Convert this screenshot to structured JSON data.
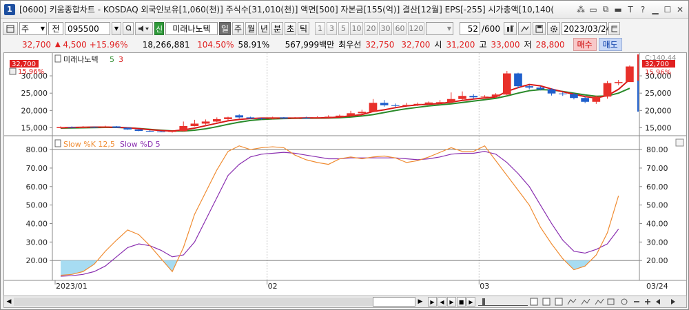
{
  "window": {
    "number": "1",
    "title": "[0600] 키움종합차트 - KOSDAQ 외국인보유[1,060(천)] 주식수[31,010(천)] 액면[500] 자본금[155(억)] 결산[12월] EPS[-255] 시가총액[10,140(",
    "controls": [
      "⁂",
      "▭",
      "⧉",
      "▬",
      "T",
      "?",
      "▁",
      "☐",
      "✕"
    ]
  },
  "toolbar": {
    "type_label": "주",
    "all_label": "전",
    "code_value": "095500",
    "stock_badge": "신",
    "stock_name": "미래나노텍",
    "period_tabs": [
      "일",
      "주",
      "월",
      "년",
      "분",
      "초",
      "틱"
    ],
    "minute_options": [
      "1",
      "3",
      "5",
      "10",
      "20",
      "30",
      "60",
      "120"
    ],
    "count_value": "52",
    "count_total": "/600",
    "date_value": "2023/03/24"
  },
  "quote": {
    "price": "32,700",
    "change": "4,500",
    "change_pct": "+15.96%",
    "volume": "18,266,881",
    "ratio1": "104.50%",
    "ratio2": "58.91%",
    "amount": "567,999백만",
    "best_label": "최우선",
    "best_sell": "32,750",
    "best_buy": "32,700",
    "open_label": "시",
    "open": "31,200",
    "high_label": "고",
    "high": "33,000",
    "low_label": "저",
    "low": "28,800",
    "buy_label": "매수",
    "sell_label": "매도"
  },
  "price_panel": {
    "name_label": "미래나노텍",
    "ma_short": "5",
    "ma_long": "3",
    "price_tag": "32,700",
    "pct_tag": "15.96%",
    "right_top_label": "C:140.44",
    "y_labels": [
      "30,000",
      "25,000",
      "20,000",
      "15,000"
    ]
  },
  "stoch_panel": {
    "label_k": "Slow %K 12,5",
    "label_d": "Slow %D 5",
    "y_labels": [
      "80.00",
      "70.00",
      "60.00",
      "50.00",
      "40.00",
      "30.00",
      "20.00"
    ]
  },
  "x_axis": {
    "labels": [
      "2023/01",
      "02",
      "03"
    ],
    "right_label": "03/24"
  },
  "chart_data": {
    "type": "line",
    "x_unit": "trading-day index",
    "candles": [
      {
        "o": 14900,
        "c": 15200,
        "h": 15400,
        "l": 14800
      },
      {
        "o": 15200,
        "c": 15000,
        "h": 15400,
        "l": 14900
      },
      {
        "o": 15000,
        "c": 15300,
        "h": 15500,
        "l": 14900
      },
      {
        "o": 15300,
        "c": 15100,
        "h": 15400,
        "l": 14900
      },
      {
        "o": 15100,
        "c": 15400,
        "h": 15600,
        "l": 15000
      },
      {
        "o": 15400,
        "c": 15000,
        "h": 15500,
        "l": 14900
      },
      {
        "o": 15000,
        "c": 14500,
        "h": 15100,
        "l": 14400
      },
      {
        "o": 14500,
        "c": 14100,
        "h": 14600,
        "l": 14000
      },
      {
        "o": 14100,
        "c": 13900,
        "h": 14300,
        "l": 13800
      },
      {
        "o": 13900,
        "c": 13800,
        "h": 14100,
        "l": 13700
      },
      {
        "o": 13800,
        "c": 14000,
        "h": 14200,
        "l": 13600
      },
      {
        "o": 14000,
        "c": 15500,
        "h": 16800,
        "l": 13900
      },
      {
        "o": 15500,
        "c": 16200,
        "h": 17300,
        "l": 15400
      },
      {
        "o": 16200,
        "c": 16800,
        "h": 17400,
        "l": 15900
      },
      {
        "o": 16800,
        "c": 17500,
        "h": 18000,
        "l": 16600
      },
      {
        "o": 17500,
        "c": 18000,
        "h": 18200,
        "l": 17200
      },
      {
        "o": 18600,
        "c": 18000,
        "h": 18900,
        "l": 17700
      },
      {
        "o": 18000,
        "c": 17700,
        "h": 18200,
        "l": 17500
      },
      {
        "o": 17700,
        "c": 17600,
        "h": 17900,
        "l": 17300
      },
      {
        "o": 17600,
        "c": 18000,
        "h": 18200,
        "l": 17400
      },
      {
        "o": 18000,
        "c": 17700,
        "h": 18100,
        "l": 17500
      },
      {
        "o": 17700,
        "c": 17900,
        "h": 18100,
        "l": 17500
      },
      {
        "o": 17900,
        "c": 17800,
        "h": 18200,
        "l": 17600
      },
      {
        "o": 17800,
        "c": 18000,
        "h": 18300,
        "l": 17700
      },
      {
        "o": 18000,
        "c": 18200,
        "h": 18600,
        "l": 17900
      },
      {
        "o": 18200,
        "c": 18500,
        "h": 18800,
        "l": 18100
      },
      {
        "o": 18500,
        "c": 19200,
        "h": 19900,
        "l": 18300
      },
      {
        "o": 19200,
        "c": 19600,
        "h": 20200,
        "l": 18900
      },
      {
        "o": 19600,
        "c": 22200,
        "h": 23300,
        "l": 19500
      },
      {
        "o": 22200,
        "c": 21500,
        "h": 23000,
        "l": 21100
      },
      {
        "o": 21500,
        "c": 21300,
        "h": 22000,
        "l": 21000
      },
      {
        "o": 21300,
        "c": 21600,
        "h": 22200,
        "l": 21000
      },
      {
        "o": 21600,
        "c": 21900,
        "h": 22300,
        "l": 21300
      },
      {
        "o": 21900,
        "c": 22300,
        "h": 22600,
        "l": 21700
      },
      {
        "o": 22300,
        "c": 22400,
        "h": 23000,
        "l": 22000
      },
      {
        "o": 22400,
        "c": 23300,
        "h": 25200,
        "l": 22200
      },
      {
        "o": 23300,
        "c": 24200,
        "h": 25500,
        "l": 23000
      },
      {
        "o": 24200,
        "c": 23800,
        "h": 24700,
        "l": 23400
      },
      {
        "o": 23800,
        "c": 24000,
        "h": 24400,
        "l": 23500
      },
      {
        "o": 24000,
        "c": 24600,
        "h": 25000,
        "l": 23700
      },
      {
        "o": 24600,
        "c": 30700,
        "h": 31400,
        "l": 24400
      },
      {
        "o": 30700,
        "c": 27000,
        "h": 30900,
        "l": 26400
      },
      {
        "o": 27000,
        "c": 26600,
        "h": 27400,
        "l": 26100
      },
      {
        "o": 26600,
        "c": 26100,
        "h": 27000,
        "l": 25800
      },
      {
        "o": 26100,
        "c": 24900,
        "h": 26400,
        "l": 24300
      },
      {
        "o": 24900,
        "c": 24700,
        "h": 25300,
        "l": 24200
      },
      {
        "o": 24700,
        "c": 23600,
        "h": 25000,
        "l": 23200
      },
      {
        "o": 23600,
        "c": 22500,
        "h": 24000,
        "l": 22100
      },
      {
        "o": 22500,
        "c": 24000,
        "h": 24300,
        "l": 21900
      },
      {
        "o": 24000,
        "c": 27900,
        "h": 28500,
        "l": 23400
      },
      {
        "o": 27900,
        "c": 28200,
        "h": 28800,
        "l": 27300
      },
      {
        "o": 28200,
        "c": 32700,
        "h": 33000,
        "l": 28800
      }
    ],
    "ma_short": [
      15000,
      15100,
      15150,
      15180,
      15200,
      15150,
      15000,
      14750,
      14450,
      14200,
      14050,
      14400,
      14900,
      15600,
      16300,
      17000,
      17400,
      17650,
      17800,
      17800,
      17800,
      17800,
      17850,
      17850,
      17900,
      18100,
      18450,
      18800,
      19700,
      20200,
      20800,
      21300,
      21600,
      21800,
      22000,
      22400,
      22900,
      23300,
      23600,
      23900,
      25500,
      26600,
      27500,
      27100,
      26200,
      25400,
      24700,
      24000,
      23600,
      24300,
      26100,
      29000
    ],
    "ma_long": [
      14900,
      14950,
      15000,
      15050,
      15100,
      15100,
      15000,
      14800,
      14550,
      14300,
      14100,
      14050,
      14300,
      14700,
      15300,
      16000,
      16600,
      17100,
      17400,
      17550,
      17650,
      17700,
      17750,
      17750,
      17800,
      17900,
      18100,
      18400,
      18800,
      19400,
      20000,
      20500,
      20900,
      21300,
      21600,
      21900,
      22300,
      22700,
      23100,
      23500,
      24200,
      25000,
      25700,
      26000,
      25900,
      25500,
      25000,
      24500,
      24100,
      24200,
      25000,
      26400
    ],
    "slow_k": [
      12,
      12.5,
      14,
      18,
      25,
      31,
      36.5,
      34,
      28,
      21,
      14,
      27,
      45,
      57,
      69,
      79,
      82,
      80,
      81,
      81.5,
      81,
      77,
      74.5,
      73,
      72,
      75,
      76,
      75,
      76,
      76.5,
      75.5,
      73,
      74,
      76,
      78.5,
      81,
      79,
      79,
      82,
      74,
      66,
      58,
      50,
      38,
      29,
      21,
      15,
      17,
      23,
      35,
      55
    ],
    "slow_d": [
      11.5,
      11.8,
      12.5,
      14,
      17,
      22,
      27,
      29,
      28,
      25.5,
      22,
      23,
      30,
      42,
      54,
      66,
      72,
      76,
      77.5,
      78,
      78.5,
      78,
      77,
      76,
      75,
      75,
      75.5,
      75.5,
      75.5,
      75.5,
      75.5,
      75,
      74.5,
      75,
      76,
      77.5,
      78,
      78,
      79,
      77.5,
      73,
      67,
      60,
      50,
      40,
      31,
      25,
      24,
      26,
      29,
      37
    ],
    "k_threshold_high": 80,
    "k_threshold_low": 20,
    "price_ylim": [
      13500,
      33000
    ],
    "stoch_ylim": [
      10,
      86
    ],
    "month_starts": [
      0,
      19,
      38
    ],
    "colors": {
      "up": "#e8302a",
      "down": "#1f5fcc",
      "ma_short": "#d81818",
      "ma_long": "#2a8a2a",
      "slow_k": "#f08c32",
      "slow_d": "#8a2fb0",
      "oversold_fill": "#a7dcf2"
    }
  },
  "scroll": {
    "left_arrow": "◀",
    "right_arrow": "▶",
    "controls": [
      "▶",
      "◀",
      "▶",
      "■",
      "▶"
    ]
  }
}
